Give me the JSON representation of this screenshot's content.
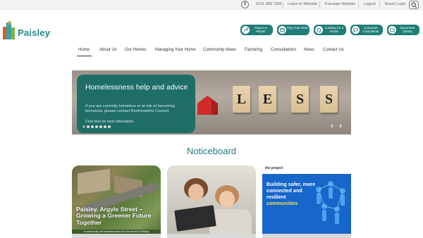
{
  "topbar": {
    "facebook_icon": "facebook-icon",
    "phone": "0141 889 7305",
    "links": [
      "Listen to Website",
      "Translate Website",
      "Logout",
      "Board Login"
    ],
    "search_icon": "search-icon"
  },
  "brand": {
    "name": "Paisley",
    "colors": {
      "teal": "#1f8b8a",
      "dark_teal": "#1f7c76",
      "orange": "#d2612a",
      "green": "#7cb342"
    }
  },
  "quick_actions": [
    {
      "label": "Report a Repair",
      "icon": "wrench-icon"
    },
    {
      "label": "Pay Your Rent",
      "icon": "card-icon"
    },
    {
      "label": "Looking for a Home",
      "icon": "house-icon"
    },
    {
      "label": "Customer Complaints",
      "icon": "chat-icon"
    },
    {
      "label": "Document Library",
      "icon": "folder-icon"
    }
  ],
  "nav": {
    "items": [
      "Home",
      "About Us",
      "Our Homes",
      "Managing Your Home",
      "Community News",
      "Factoring",
      "Consultations",
      "News",
      "Contact Us"
    ],
    "active": "Home"
  },
  "hero": {
    "title": "Homelessness help and advice",
    "body": "If you are currently homeless or at risk of becoming homeless, please contact Renfrewshire Council.",
    "link": "Click here for more information.",
    "letters": [
      "L",
      "E",
      "S",
      "S"
    ],
    "slide_count": 7,
    "active_slide": 1
  },
  "noticeboard": {
    "title": "Noticeboard",
    "cards": [
      {
        "title": "Paisley, Argyle Street – Growing a Greener Future Together",
        "caption": "A community-led transformation for the Heart of Paisley"
      },
      {
        "title": ""
      },
      {
        "brand": "the project",
        "lines": [
          "Building safer, more",
          "connected and",
          "resilient",
          "communities"
        ]
      }
    ]
  }
}
